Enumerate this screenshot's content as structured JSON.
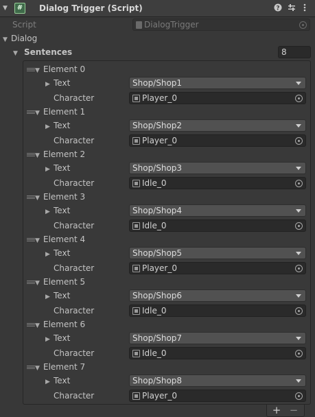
{
  "header": {
    "icon": "#",
    "title": "Dialog Trigger (Script)",
    "icons": [
      "help-icon",
      "settings-icon",
      "more-icon"
    ]
  },
  "script_field": {
    "label": "Script",
    "value": "DialogTrigger"
  },
  "dialog_label": "Dialog",
  "sentences": {
    "label": "Sentences",
    "size": "8"
  },
  "text_label": "Text",
  "character_label": "Character",
  "elements": [
    {
      "label": "Element 0",
      "text": "Shop/Shop1",
      "character": "Player_0"
    },
    {
      "label": "Element 1",
      "text": "Shop/Shop2",
      "character": "Player_0"
    },
    {
      "label": "Element 2",
      "text": "Shop/Shop3",
      "character": "Idle_0"
    },
    {
      "label": "Element 3",
      "text": "Shop/Shop4",
      "character": "Idle_0"
    },
    {
      "label": "Element 4",
      "text": "Shop/Shop5",
      "character": "Player_0"
    },
    {
      "label": "Element 5",
      "text": "Shop/Shop6",
      "character": "Idle_0"
    },
    {
      "label": "Element 6",
      "text": "Shop/Shop7",
      "character": "Idle_0"
    },
    {
      "label": "Element 7",
      "text": "Shop/Shop8",
      "character": "Player_0"
    }
  ],
  "footer": {
    "add": "+",
    "remove": "−"
  },
  "colors": {
    "panel_bg": "#383838",
    "field_bg": "#2a2a2a",
    "dropdown_bg": "#515151"
  }
}
